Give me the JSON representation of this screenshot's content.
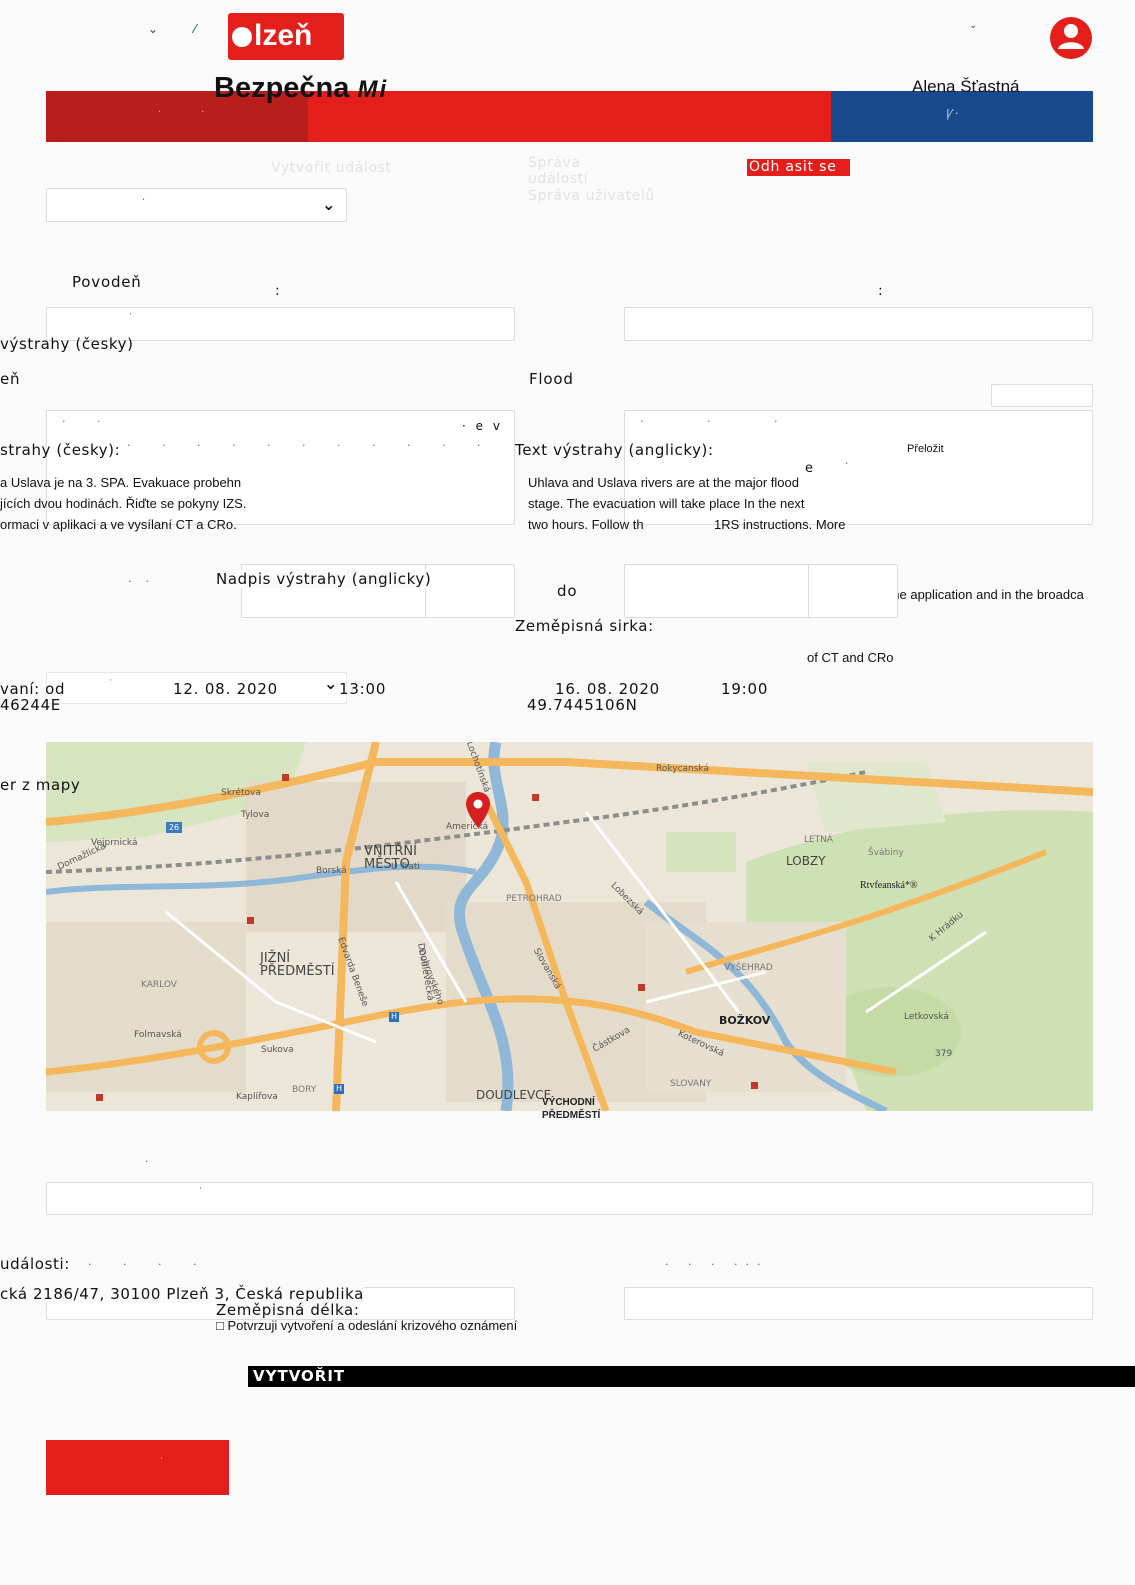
{
  "header": {
    "logo_text": "lzeň",
    "app_title": "Bezpečna",
    "app_title_italic": "Mi",
    "user_name": "Alena Šťastná",
    "colors": {
      "dark_red": "#b81e1c",
      "red": "#e41e1a",
      "blue": "#1a4a8e"
    }
  },
  "nav": {
    "create_event": "Vytvořit událost",
    "manage_events": "Správa událostí",
    "manage_users": "Správa uživatelů",
    "logout": "Odh asit se"
  },
  "form": {
    "event_type_value": "Povodeň",
    "title_cz_label": "výstrahy (česky)",
    "title_cz_value": "eň",
    "title_en_label": "Nadpis výstrahy (anglicky)",
    "title_en_value": "Flood",
    "text_cz_label": "strahy (česky):",
    "text_cz_lines": [
      "a Uslava je na 3. SPA. Evakuace probehn",
      "jících dvou hodinách. Řiďte se pokyny IZS.",
      "ormaci v aplikaci a ve vysílaní CT a CRo."
    ],
    "text_en_label": "Text výstrahy (anglicky):",
    "translate_label": "Přeložit",
    "text_en_lines": [
      "Uhlava and Uslava rivers are at the major flood",
      "stage. The evacuation will take place In the next",
      "two hours. Follow th",
      "1RS instructions. More",
      "information in the application and in the broadca",
      "of CT and CRo"
    ],
    "stray_char": "e",
    "time_label": "vaní: od",
    "date_from": "12. 08. 2020",
    "time_from": "13:00",
    "to_label": "do",
    "date_to": "16. 08. 2020",
    "time_to": "19:00",
    "lat_label": "Zeměpisná sirka:",
    "lat_value": "49.7445106N",
    "lon_partial": "46244E",
    "lon_label": "Zeměpisná délka:",
    "map_select_label": "er z mapy",
    "address_label": "události:",
    "address_value": "cká 2186/47, 30100 Plzeň 3, Česká republika",
    "confirm_label": "□ Potvrzuji vytvoření a odeslání krizového oznámení",
    "create_button": "VYTVOŘIT"
  },
  "map": {
    "districts": [
      "VNITŘNÍ MĚSTO",
      "JIŽNÍ PŘEDMĚSTÍ",
      "LOBZY",
      "BOŽKOV",
      "DOUDLEVCE",
      "VÝCHODNÍ PŘEDMĚSTÍ",
      "PETROHRAD",
      "VÝŠEHRAD",
      "SLOVANY",
      "KARLOV",
      "LETNÁ",
      "BORY"
    ],
    "streets": [
      "Rokycanská",
      "Sukova",
      "Slovanská",
      "Koterovská",
      "Folmavská",
      "U Trati",
      "Borská",
      "Americká",
      "Tylova",
      "Skrétova",
      "Dobrovského",
      "Lobezská",
      "Edvarda Beneše",
      "Kaplířova",
      "Doudlevecká",
      "Částkova",
      "Letkovská",
      "K Hrádku",
      "Rtvfeanská*®",
      "Švábiny",
      "Vejprnická",
      "Domažlická",
      "Lochotínská"
    ],
    "road_number": "379"
  }
}
